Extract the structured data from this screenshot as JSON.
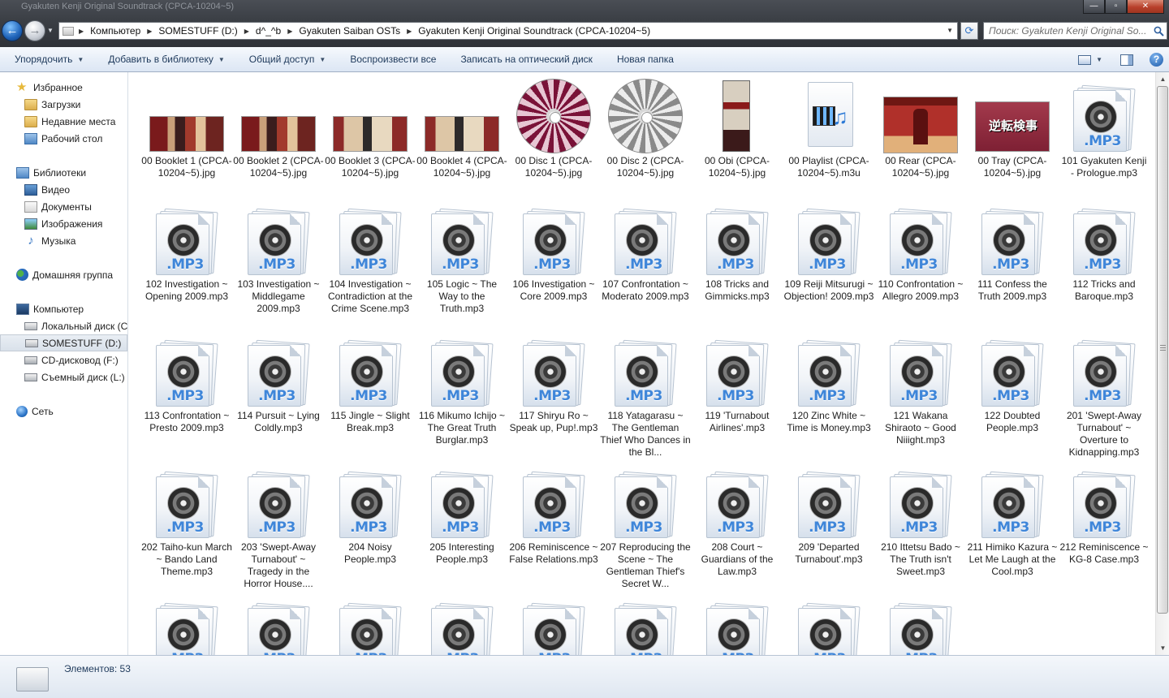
{
  "window": {
    "title": "Gyakuten Kenji Original Soundtrack (CPCA-10204~5)",
    "controls": {
      "minimize": "—",
      "maximize": "▫",
      "close": "✕"
    }
  },
  "address": {
    "breadcrumbs": [
      "Компьютер",
      "SOMESTUFF (D:)",
      "d^_^b",
      "Gyakuten Saiban OSTs",
      "Gyakuten Kenji Original Soundtrack (CPCA-10204~5)"
    ],
    "search_placeholder": "Поиск: Gyakuten Kenji Original So..."
  },
  "toolbar": {
    "organize": "Упорядочить",
    "add_to_library": "Добавить в библиотеку",
    "share": "Общий доступ",
    "play_all": "Воспроизвести все",
    "burn": "Записать на оптический диск",
    "new_folder": "Новая папка"
  },
  "sidebar": {
    "favorites": "Избранное",
    "favorites_items": [
      "Загрузки",
      "Недавние места",
      "Рабочий стол"
    ],
    "libraries": "Библиотеки",
    "libraries_items": [
      "Видео",
      "Документы",
      "Изображения",
      "Музыка"
    ],
    "homegroup": "Домашняя группа",
    "computer": "Компьютер",
    "computer_items": [
      "Локальный диск (C",
      "SOMESTUFF (D:)",
      "CD-дисковод (F:)",
      "Съемный диск (L:)"
    ],
    "selected": "SOMESTUFF (D:)",
    "network": "Сеть"
  },
  "files": [
    {
      "name": "00 Booklet 1 (CPCA-10204~5).jpg",
      "icon": "booklet"
    },
    {
      "name": "00 Booklet 2 (CPCA-10204~5).jpg",
      "icon": "booklet"
    },
    {
      "name": "00 Booklet 3 (CPCA-10204~5).jpg",
      "icon": "booklet b3"
    },
    {
      "name": "00 Booklet 4 (CPCA-10204~5).jpg",
      "icon": "booklet b4"
    },
    {
      "name": "00 Disc 1 (CPCA-10204~5).jpg",
      "icon": "disc d1"
    },
    {
      "name": "00 Disc 2 (CPCA-10204~5).jpg",
      "icon": "disc d2"
    },
    {
      "name": "00 Obi (CPCA-10204~5).jpg",
      "icon": "obi"
    },
    {
      "name": "00 Playlist (CPCA-10204~5).m3u",
      "icon": "playlist"
    },
    {
      "name": "00 Rear (CPCA-10204~5).jpg",
      "icon": "rear"
    },
    {
      "name": "00 Tray (CPCA-10204~5).jpg",
      "icon": "tray"
    },
    {
      "name": "101 Gyakuten Kenji - Prologue.mp3",
      "icon": "mp3"
    },
    {
      "name": "102 Investigation ~ Opening 2009.mp3",
      "icon": "mp3"
    },
    {
      "name": "103 Investigation ~ Middlegame 2009.mp3",
      "icon": "mp3"
    },
    {
      "name": "104 Investigation ~ Contradiction at the Crime Scene.mp3",
      "icon": "mp3"
    },
    {
      "name": "105 Logic ~ The Way to the Truth.mp3",
      "icon": "mp3"
    },
    {
      "name": "106 Investigation ~ Core 2009.mp3",
      "icon": "mp3"
    },
    {
      "name": "107 Confrontation ~ Moderato 2009.mp3",
      "icon": "mp3"
    },
    {
      "name": "108 Tricks and Gimmicks.mp3",
      "icon": "mp3"
    },
    {
      "name": "109 Reiji Mitsurugi ~ Objection! 2009.mp3",
      "icon": "mp3"
    },
    {
      "name": "110 Confrontation ~ Allegro 2009.mp3",
      "icon": "mp3"
    },
    {
      "name": "111 Confess the Truth 2009.mp3",
      "icon": "mp3"
    },
    {
      "name": "112 Tricks and Baroque.mp3",
      "icon": "mp3"
    },
    {
      "name": "113 Confrontation ~ Presto 2009.mp3",
      "icon": "mp3"
    },
    {
      "name": "114 Pursuit ~ Lying Coldly.mp3",
      "icon": "mp3"
    },
    {
      "name": "115 Jingle ~ Slight Break.mp3",
      "icon": "mp3"
    },
    {
      "name": "116 Mikumo Ichijo ~ The Great Truth Burglar.mp3",
      "icon": "mp3"
    },
    {
      "name": "117 Shiryu Ro ~ Speak up, Pup!.mp3",
      "icon": "mp3"
    },
    {
      "name": "118 Yatagarasu ~ The Gentleman Thief Who Dances in the Bl...",
      "icon": "mp3"
    },
    {
      "name": "119 'Turnabout Airlines'.mp3",
      "icon": "mp3"
    },
    {
      "name": "120 Zinc White ~ Time is Money.mp3",
      "icon": "mp3"
    },
    {
      "name": "121 Wakana Shiraoto ~ Good Niiight.mp3",
      "icon": "mp3"
    },
    {
      "name": "122 Doubted People.mp3",
      "icon": "mp3"
    },
    {
      "name": "201 'Swept-Away Turnabout' ~ Overture to Kidnapping.mp3",
      "icon": "mp3"
    },
    {
      "name": "202 Taiho-kun March ~ Bando Land Theme.mp3",
      "icon": "mp3"
    },
    {
      "name": "203 'Swept-Away Turnabout' ~ Tragedy in the Horror House....",
      "icon": "mp3"
    },
    {
      "name": "204 Noisy People.mp3",
      "icon": "mp3"
    },
    {
      "name": "205 Interesting People.mp3",
      "icon": "mp3"
    },
    {
      "name": "206 Reminiscence ~ False Relations.mp3",
      "icon": "mp3"
    },
    {
      "name": "207 Reproducing the Scene ~ The Gentleman Thief's Secret W...",
      "icon": "mp3"
    },
    {
      "name": "208 Court ~ Guardians of the Law.mp3",
      "icon": "mp3"
    },
    {
      "name": "209 'Departed Turnabout'.mp3",
      "icon": "mp3"
    },
    {
      "name": "210 Ittetsu Bado ~ The Truth isn't Sweet.mp3",
      "icon": "mp3"
    },
    {
      "name": "211 Himiko Kazura ~ Let Me Laugh at the Cool.mp3",
      "icon": "mp3"
    },
    {
      "name": "212 Reminiscence ~ KG-8 Case.mp3",
      "icon": "mp3"
    },
    {
      "name": "",
      "icon": "mp3"
    },
    {
      "name": "",
      "icon": "mp3"
    },
    {
      "name": "",
      "icon": "mp3"
    },
    {
      "name": "",
      "icon": "mp3"
    },
    {
      "name": "",
      "icon": "mp3"
    },
    {
      "name": "",
      "icon": "mp3"
    },
    {
      "name": "",
      "icon": "mp3"
    },
    {
      "name": "",
      "icon": "mp3"
    },
    {
      "name": "",
      "icon": "mp3"
    }
  ],
  "mp3_label": ".MP3",
  "status": {
    "count": "Элементов: 53"
  },
  "colors": {
    "accent": "#1e395b",
    "selection": "#d9e1ea",
    "mp3_text": "#3f86d9"
  }
}
